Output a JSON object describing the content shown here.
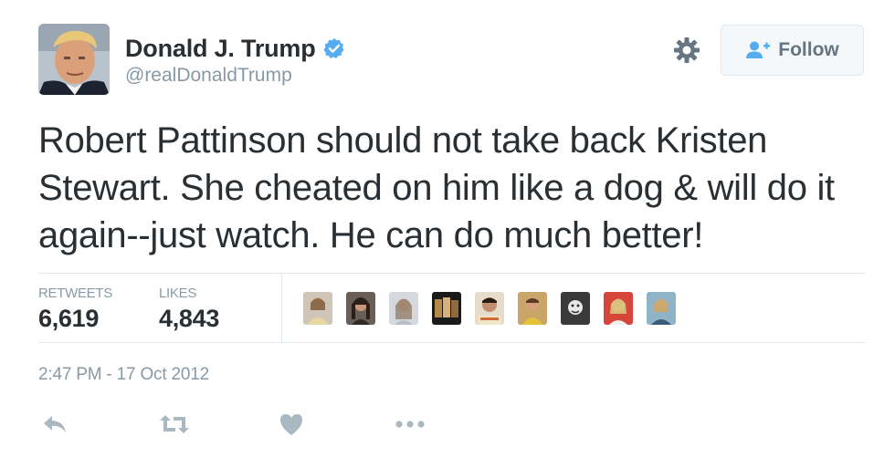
{
  "user": {
    "name": "Donald J. Trump",
    "handle": "@realDonaldTrump",
    "verified_icon": "verified-badge-icon"
  },
  "header": {
    "follow_label": "Follow",
    "gear_icon": "gear-icon",
    "follow_icon": "add-user-icon"
  },
  "tweet": {
    "text": "Robert Pattinson should not take back Kristen Stewart. She cheated on him like a dog & will do it again--just watch. He can do much better!"
  },
  "stats": {
    "retweets_label": "RETWEETS",
    "retweets_value": "6,619",
    "likes_label": "LIKES",
    "likes_value": "4,843"
  },
  "timestamp": "2:47 PM - 17 Oct 2012",
  "actions": [
    "reply-icon",
    "retweet-icon",
    "like-icon",
    "more-icon"
  ],
  "colors": {
    "text": "#292f33",
    "muted": "#8899a6",
    "verified": "#55acee",
    "icon": "#aab8c2",
    "divider": "#e1e8ed"
  }
}
